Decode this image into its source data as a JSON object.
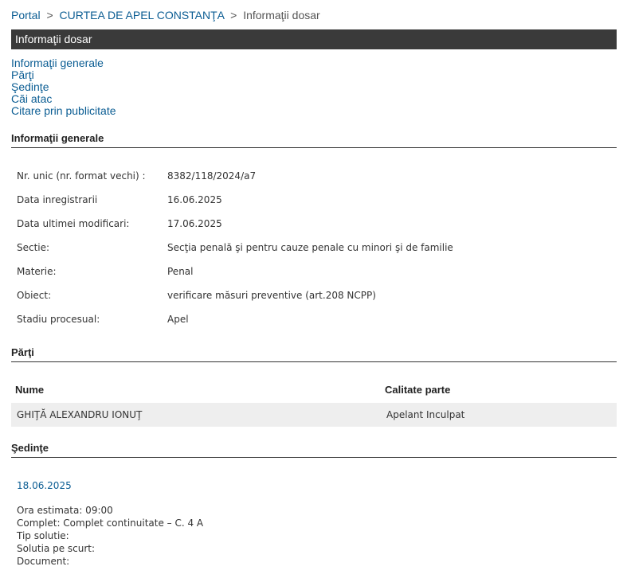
{
  "breadcrumb": {
    "portal": "Portal",
    "court": "CURTEA DE APEL CONSTANŢA",
    "current": "Informaţii dosar",
    "sep": ">"
  },
  "page_title": "Informaţii dosar",
  "anchors": [
    "Informaţii generale",
    "Părţi",
    "Şedinţe",
    "Căi atac",
    "Citare prin publicitate"
  ],
  "general": {
    "heading": "Informaţii generale",
    "rows": [
      {
        "label": "Nr. unic (nr. format vechi) :",
        "value": "8382/118/2024/a7"
      },
      {
        "label": "Data inregistrarii",
        "value": "16.06.2025"
      },
      {
        "label": "Data ultimei modificari:",
        "value": "17.06.2025"
      },
      {
        "label": "Sectie:",
        "value": "Secţia penală şi pentru cauze penale cu minori şi de familie"
      },
      {
        "label": "Materie:",
        "value": "Penal"
      },
      {
        "label": "Obiect:",
        "value": "verificare măsuri preventive (art.208 NCPP)"
      },
      {
        "label": "Stadiu procesual:",
        "value": "Apel"
      }
    ]
  },
  "parti": {
    "heading": "Părţi",
    "col_nume": "Nume",
    "col_calitate": "Calitate parte",
    "rows": [
      {
        "nume": "GHIŢĂ ALEXANDRU IONUŢ",
        "calitate": "Apelant Inculpat"
      }
    ]
  },
  "sedinte": {
    "heading": "Şedinţe",
    "date": "18.06.2025",
    "lines": [
      "Ora estimata: 09:00",
      "Complet: Complet continuitate – C. 4 A",
      "Tip solutie:",
      "Solutia pe scurt:",
      "Document:"
    ]
  }
}
